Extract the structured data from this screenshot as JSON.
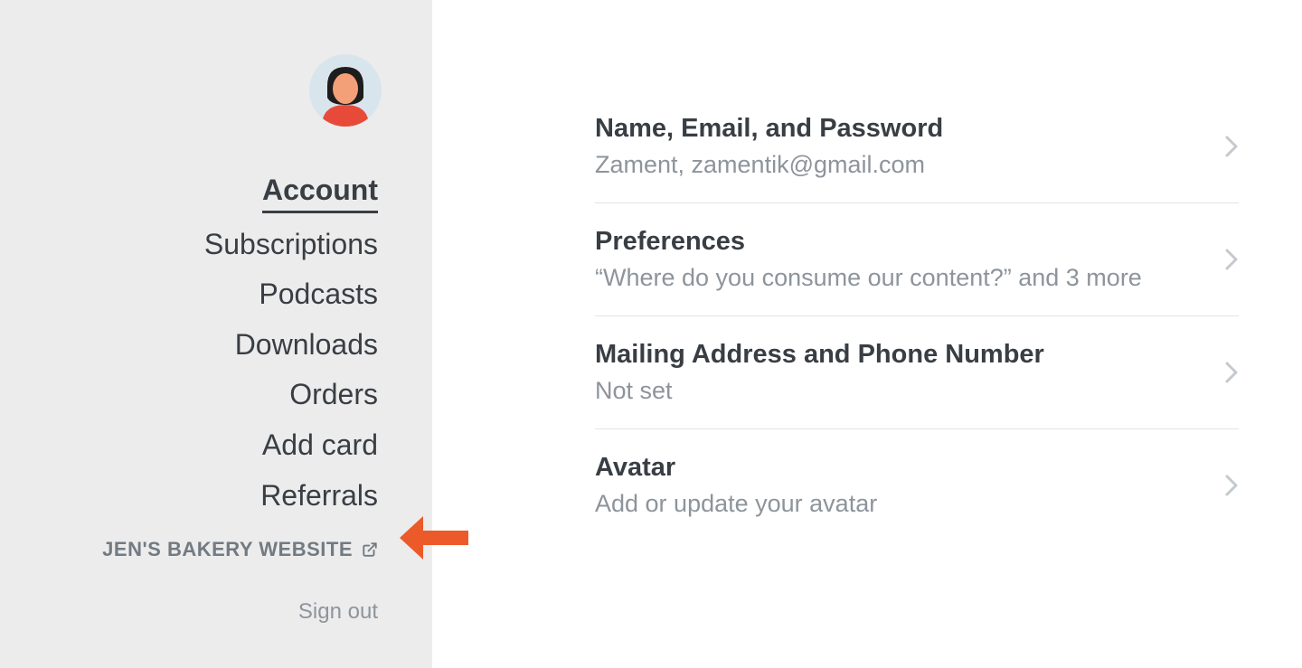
{
  "sidebar": {
    "nav": [
      {
        "label": "Account",
        "active": true
      },
      {
        "label": "Subscriptions",
        "active": false
      },
      {
        "label": "Podcasts",
        "active": false
      },
      {
        "label": "Downloads",
        "active": false
      },
      {
        "label": "Orders",
        "active": false
      },
      {
        "label": "Add card",
        "active": false
      },
      {
        "label": "Referrals",
        "active": false
      }
    ],
    "external_link_label": "JEN'S BAKERY WEBSITE",
    "sign_out_label": "Sign out"
  },
  "main": {
    "items": [
      {
        "title": "Name, Email, and Password",
        "subtitle": "Zament, zamentik@gmail.com"
      },
      {
        "title": "Preferences",
        "subtitle": "“Where do you consume our content?” and 3 more"
      },
      {
        "title": "Mailing Address and Phone Number",
        "subtitle": "Not set"
      },
      {
        "title": "Avatar",
        "subtitle": "Add or update your avatar"
      }
    ]
  }
}
